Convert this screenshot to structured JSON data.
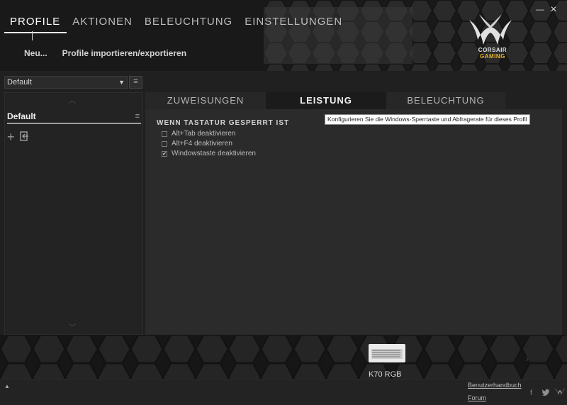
{
  "nav": {
    "items": [
      "PROFILE",
      "AKTIONEN",
      "BELEUCHTUNG",
      "EINSTELLUNGEN"
    ],
    "active": "PROFILE"
  },
  "subnav": {
    "new_label": "Neu...",
    "import_export_label": "Profile importieren/exportieren"
  },
  "window": {
    "minimize": "—",
    "close": "✕"
  },
  "logo": {
    "line1": "CORSAIR",
    "line2": "GAMING",
    "accent": "#e8b624"
  },
  "profile_select": {
    "value": "Default",
    "arrow": "▼",
    "list_icon": "≡"
  },
  "profiles": [
    {
      "name": "Default",
      "menu_icon": "≡"
    }
  ],
  "profile_actions": {
    "add_icon": "+",
    "import_icon": "import-icon"
  },
  "scroll": {
    "up": "︿",
    "down": "﹀"
  },
  "tabs": [
    {
      "label": "ZUWEISUNGEN",
      "active": false
    },
    {
      "label": "LEISTUNG",
      "active": true
    },
    {
      "label": "BELEUCHTUNG",
      "active": false
    }
  ],
  "performance": {
    "section_title": "WENN TASTATUR GESPERRT IST",
    "options": [
      {
        "label": "Alt+Tab deaktivieren",
        "checked": false
      },
      {
        "label": "Alt+F4 deaktivieren",
        "checked": false
      },
      {
        "label": "Windowstaste deaktivieren",
        "checked": true
      }
    ]
  },
  "tooltip": "Konfigurieren Sie die Windows-Sperrtaste und Abfragerate für dieses Profil",
  "device": {
    "name": "K70 RGB",
    "next_icon": "›"
  },
  "footer": {
    "up_icon": "▲",
    "manual_link": "Benutzerhandbuch",
    "forum_link": "Forum",
    "facebook": "f",
    "twitter": "🐦",
    "corsair": "corsair-icon"
  }
}
